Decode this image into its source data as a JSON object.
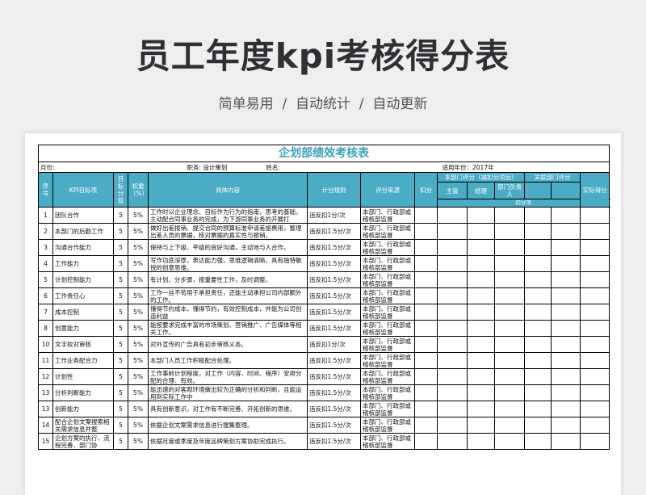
{
  "page": {
    "title": "员工年度kpi考核得分表",
    "subtitle": "简单易用  /  自动统计  /  自动更新"
  },
  "sheet": {
    "title": "企划部绩效考核表",
    "month_label": "月份:",
    "position_label": "职务: 设计策划",
    "name_label": "姓名:",
    "year_label": "适用年份：2017年",
    "headers": {
      "no": "序号",
      "kpi": "KPI目标项",
      "target": "目标分值",
      "weight": "权重（%）",
      "content": "具体内容",
      "rule": "计分规则",
      "source": "评分来源",
      "deduct": "扣分",
      "dept_group": "本部门评分（减扣分项后）",
      "related_group": "关联部门评分",
      "actual": "实际得分",
      "supervisor": "主管",
      "manager": "经理",
      "dept_head": "部门负责人"
    },
    "band_label": "扣分项",
    "rows": [
      {
        "no": "1",
        "kpi": "团队合作",
        "score": "5",
        "weight": "5%",
        "content": "工作时以企业理念、目标作为行为的指南，思考的基础，主动配合同事业务的完成，为下游同事业务的开展打",
        "rule": "违反扣1分/次",
        "source": "本部门、行政部或稽核部监督"
      },
      {
        "no": "2",
        "kpi": "本部门的后勤工作",
        "score": "5",
        "weight": "5%",
        "content": "做好出差报销、提交合同的预算标准申请差旅费用，整理出差人员的票据，核对票据的真实性与报销。",
        "rule": "违反扣1.5分/次",
        "source": "本部门、行政部或稽核部监督"
      },
      {
        "no": "3",
        "kpi": "沟通合作能力",
        "score": "5",
        "weight": "5%",
        "content": "保持与上下级、平级的良好沟通，主动地与人合作。",
        "rule": "违反扣1.5分/次",
        "source": "本部门、行政部或稽核部监督"
      },
      {
        "no": "4",
        "kpi": "工作能力",
        "score": "5",
        "weight": "5%",
        "content": "写作功底深厚，表达能力强，思维逻辑清晰，具有独特敏锐的创意思维。",
        "rule": "违反扣1.5分/次",
        "source": "本部门、行政部或稽核部监督"
      },
      {
        "no": "5",
        "kpi": "计划控制能力",
        "score": "5",
        "weight": "5%",
        "content": "有计划、分步骤，按重要性工作，及时调整。",
        "rule": "违反扣1.5分/次",
        "source": "本部门、行政部或稽核部监督"
      },
      {
        "no": "6",
        "kpi": "工作责任心",
        "score": "5",
        "weight": "5%",
        "content": "工作一丝不苟用于承担责任，还能主动承担公司内部额外的工作。",
        "rule": "违反扣1.5分/次",
        "source": "本部门、行政部或稽核部监督"
      },
      {
        "no": "7",
        "kpi": "成本控制",
        "score": "5",
        "weight": "5%",
        "content": "懂得节约成本，懂得节约，有效控制成本，并能为公司创造利益",
        "rule": "违反扣1.5分/次",
        "source": "本部门、行政部或稽核部监督"
      },
      {
        "no": "8",
        "kpi": "创意能力",
        "score": "5",
        "weight": "5%",
        "content": "能按要求完成丰富的市场策划、营销推广、广告媒体等相关工作。",
        "rule": "违反扣1.5分/次",
        "source": "本部门、行政部或稽核部监督"
      },
      {
        "no": "10",
        "kpi": "文字校对审核",
        "score": "5",
        "weight": "5%",
        "content": "对外宣传的广告具有初步审核义务。",
        "rule": "违反扣1分/次",
        "source": "本部门、行政部或稽核部监督"
      },
      {
        "no": "11",
        "kpi": "工作业务配合力",
        "score": "5",
        "weight": "5%",
        "content": "本部门人员工作积极配合处理。",
        "rule": "违反扣1.5分/次",
        "source": "本部门、行政部或稽核部监督"
      },
      {
        "no": "12",
        "kpi": "计划性",
        "score": "5",
        "weight": "5%",
        "content": "工作事前计划程度，对工作（内容、时间、程序）安排分配的合理、有效。",
        "rule": "违反扣1.5分/次",
        "source": "本部门、行政部或稽核部监督"
      },
      {
        "no": "13",
        "kpi": "分析判断能力",
        "score": "5",
        "weight": "5%",
        "content": "能迅速的对客观环境做出较为正确的分析和判断，且能运用到实际工作中",
        "rule": "违反扣1.5分/次",
        "source": "本部门、行政部或稽核部监督"
      },
      {
        "no": "13",
        "kpi": "创新能力",
        "score": "5",
        "weight": "5%",
        "content": "具有创新意识，对工作有不断完善、开拓创新的思维。",
        "rule": "违反扣1.5分/次",
        "source": "本部门、行政部或稽核部监督"
      },
      {
        "no": "14",
        "kpi": "配合企划文案搜索相关需求信息并整",
        "score": "5",
        "weight": "5%",
        "content": "依据企划文案需求信息进行搜集整理。",
        "rule": "违反扣1.5分/次",
        "source": "本部门、行政部或稽核部监督"
      },
      {
        "no": "15",
        "kpi": "企划方案的执行、流程完善、部门协",
        "score": "5",
        "weight": "5%",
        "content": "依据月度或季度及年度品牌策划方案协助完成执行。",
        "rule": "违反扣1.5分/次",
        "source": "本部门、行政部或稽核部监督"
      }
    ]
  },
  "colors": {
    "header_bg": "#4bacc6",
    "sheet_title": "#3aa2bf"
  }
}
